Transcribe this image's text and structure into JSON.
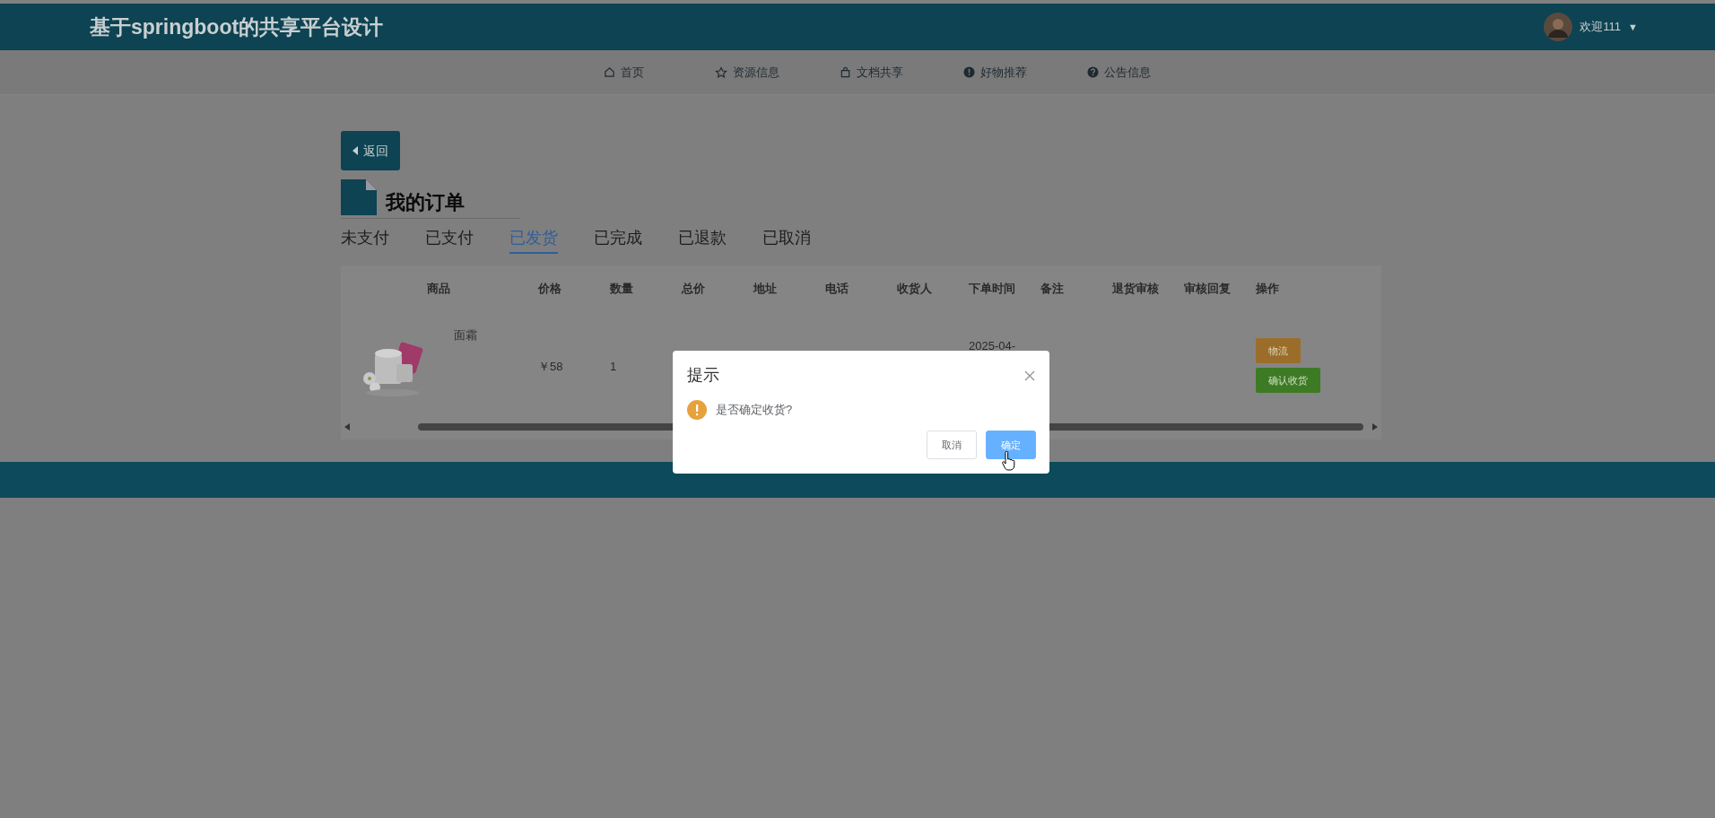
{
  "header": {
    "title": "基于springboot的共享平台设计",
    "greeting": "欢迎111",
    "caret": "▼"
  },
  "nav": [
    {
      "label": "首页"
    },
    {
      "label": "资源信息"
    },
    {
      "label": "文档共享"
    },
    {
      "label": "好物推荐"
    },
    {
      "label": "公告信息"
    }
  ],
  "back_button": "返回",
  "page_title": "我的订单",
  "tabs": [
    {
      "label": "未支付",
      "selected": false
    },
    {
      "label": "已支付",
      "selected": false
    },
    {
      "label": "已发货",
      "selected": true
    },
    {
      "label": "已完成",
      "selected": false
    },
    {
      "label": "已退款",
      "selected": false
    },
    {
      "label": "已取消",
      "selected": false
    }
  ],
  "table": {
    "columns": [
      "商品",
      "价格",
      "数量",
      "总价",
      "地址",
      "电话",
      "收货人",
      "下单时间",
      "备注",
      "退货审核",
      "审核回复",
      "操作"
    ],
    "rows": [
      {
        "product": "面霜",
        "price": "￥58",
        "quantity": "1",
        "order_time": "2025-04-",
        "actions": [
          {
            "label": "物流",
            "kind": "warning"
          },
          {
            "label": "确认收货",
            "kind": "success"
          }
        ]
      }
    ]
  },
  "dialog": {
    "title": "提示",
    "message": "是否确定收货?",
    "buttons": [
      {
        "label": "取消",
        "kind": "default"
      },
      {
        "label": "确定",
        "kind": "primary"
      }
    ]
  }
}
